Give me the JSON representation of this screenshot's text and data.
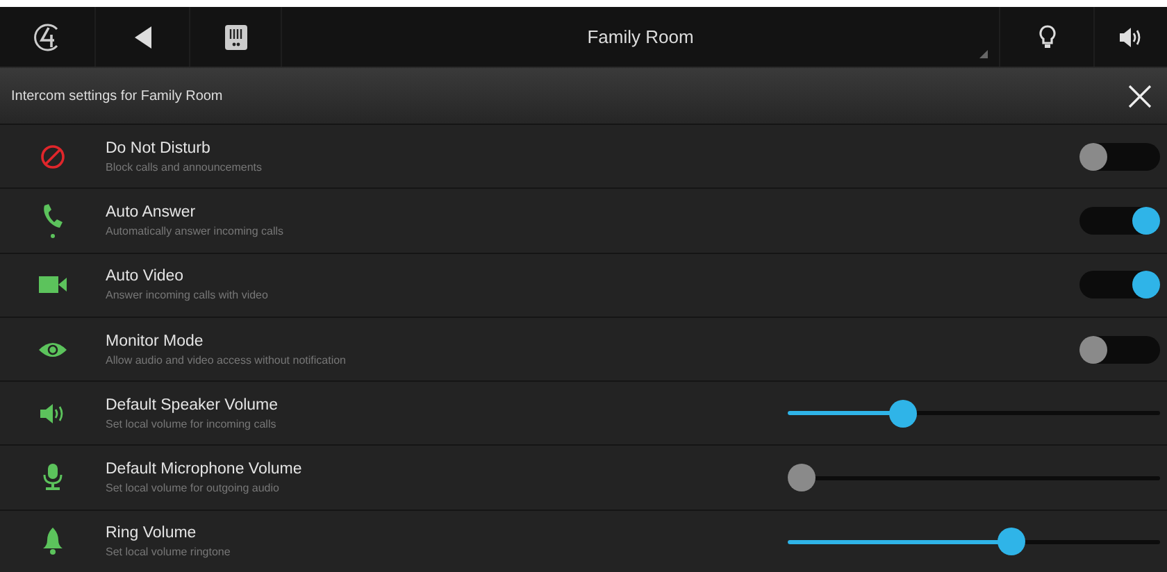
{
  "top_bar": {
    "room": "Family Room"
  },
  "panel": {
    "title": "Intercom settings for Family Room"
  },
  "settings": [
    {
      "kind": "toggle",
      "label": "Do Not Disturb",
      "description": "Block calls and announcements",
      "on": false
    },
    {
      "kind": "toggle",
      "label": "Auto Answer",
      "description": "Automatically answer incoming calls",
      "on": true
    },
    {
      "kind": "toggle",
      "label": "Auto Video",
      "description": "Answer incoming calls with video",
      "on": true
    },
    {
      "kind": "toggle",
      "label": "Monitor Mode",
      "description": "Allow audio and video access without notification",
      "on": false
    },
    {
      "kind": "slider",
      "label": "Default Speaker Volume",
      "description": "Set local volume for incoming calls",
      "level": 0.31
    },
    {
      "kind": "slider",
      "label": "Default Microphone Volume",
      "description": "Set local volume for outgoing audio",
      "level": 0
    },
    {
      "kind": "slider",
      "label": "Ring Volume",
      "description": "Set local volume ringtone",
      "level": 0.6
    }
  ]
}
